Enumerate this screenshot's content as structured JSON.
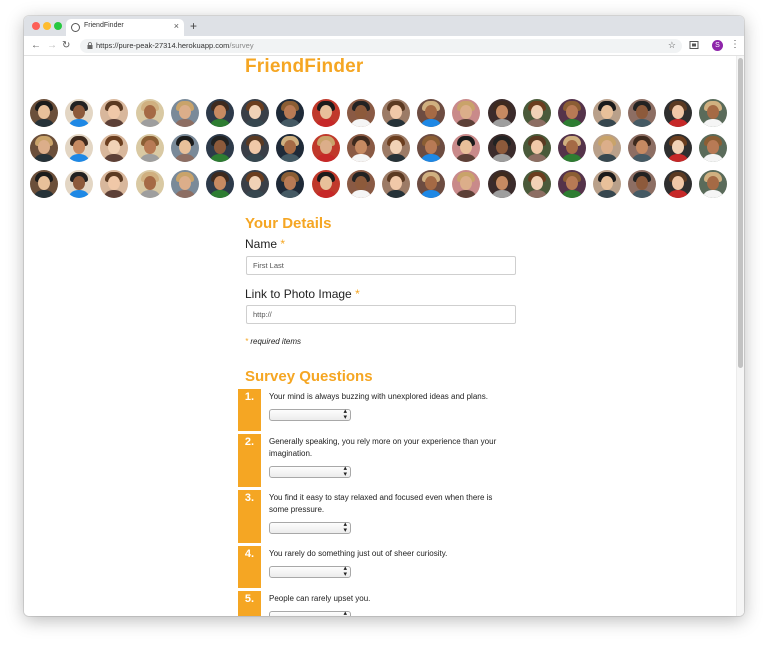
{
  "browser": {
    "tab_title": "FriendFinder",
    "tab_close": "×",
    "new_tab": "+",
    "url_host": "https://pure-peak-27314.herokuapp.com",
    "url_path": "/survey",
    "profile_initial": "S"
  },
  "page": {
    "brand": "FriendFinder",
    "details_title": "Your Details",
    "name_label": "Name",
    "name_placeholder": "First Last",
    "photo_label": "Link to Photo Image",
    "photo_placeholder": "http://",
    "required_star": "*",
    "required_note": "required items",
    "survey_title": "Survey Questions"
  },
  "questions": [
    {
      "num": "1.",
      "text": "Your mind is always buzzing with unexplored ideas and plans."
    },
    {
      "num": "2.",
      "text": "Generally speaking, you rely more on your experience than your imagination."
    },
    {
      "num": "3.",
      "text": "You find it easy to stay relaxed and focused even when there is some pressure."
    },
    {
      "num": "4.",
      "text": "You rarely do something just out of sheer curiosity."
    },
    {
      "num": "5.",
      "text": "People can rarely upset you."
    }
  ],
  "colors": {
    "accent": "#f5a623",
    "text": "#222222"
  }
}
